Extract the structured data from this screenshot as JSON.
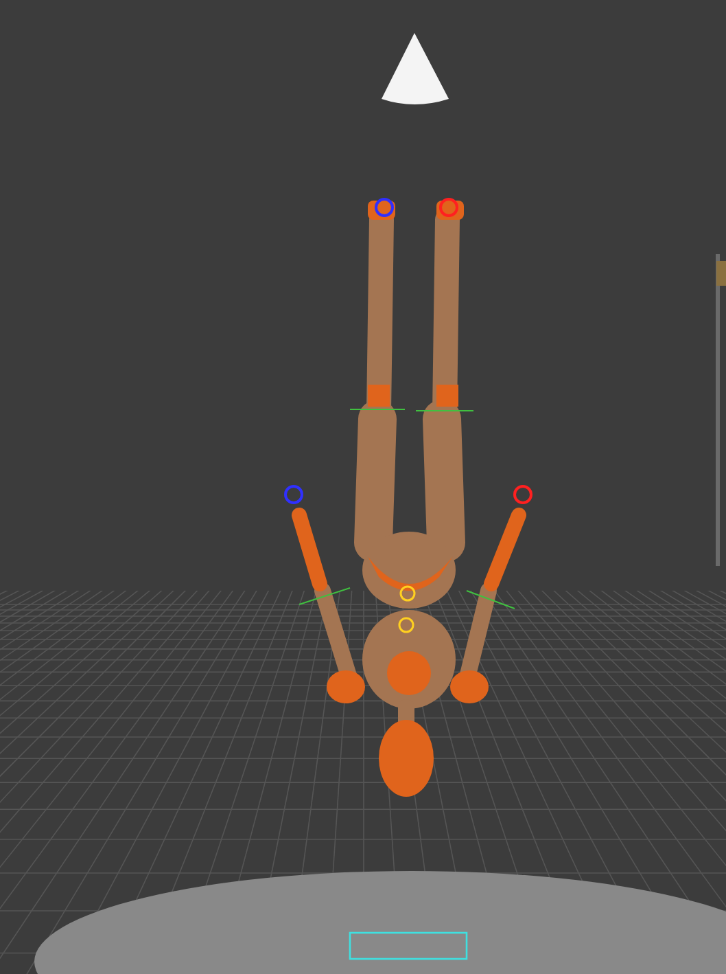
{
  "viewport": {
    "grid_visible": true,
    "light_visible": true
  }
}
